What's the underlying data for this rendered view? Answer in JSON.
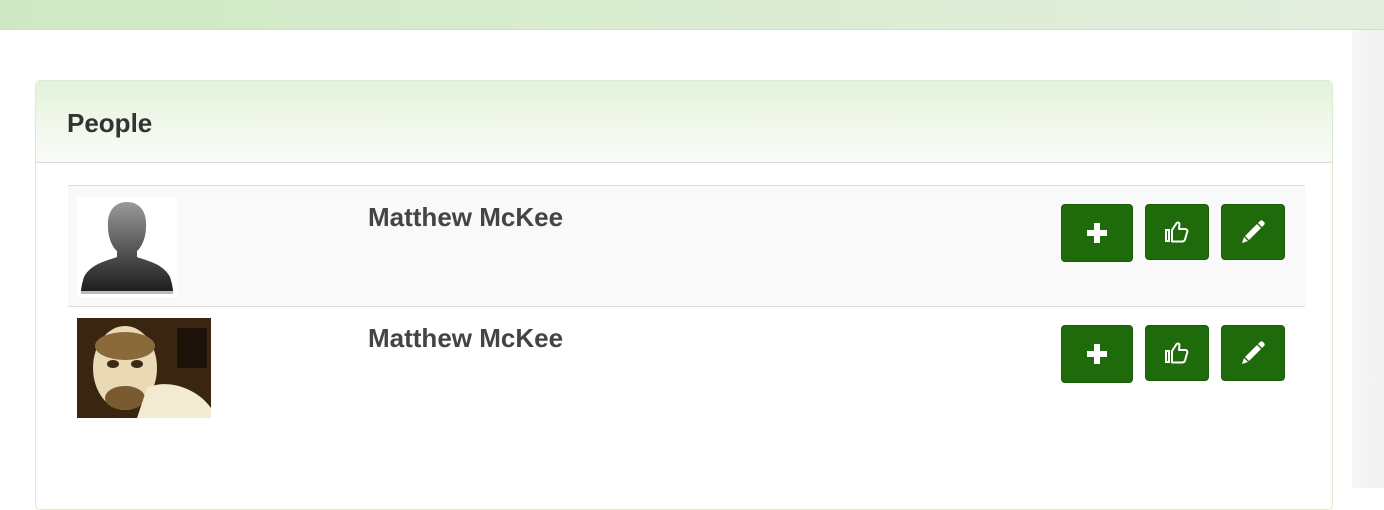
{
  "panel": {
    "title": "People"
  },
  "people": [
    {
      "name": "Matthew McKee",
      "avatar": "default-silhouette-avatar",
      "actions": [
        "plus-icon",
        "thumbs-up-icon",
        "pencil-icon"
      ]
    },
    {
      "name": "Matthew McKee",
      "avatar": "profile-photo-avatar",
      "actions": [
        "plus-icon",
        "thumbs-up-icon",
        "pencil-icon"
      ]
    }
  ],
  "colors": {
    "accent_button": "#1f6b0c",
    "header_gradient_start": "#e3f2da",
    "topbar": "#d9ecd0",
    "name_text": "#444444"
  }
}
